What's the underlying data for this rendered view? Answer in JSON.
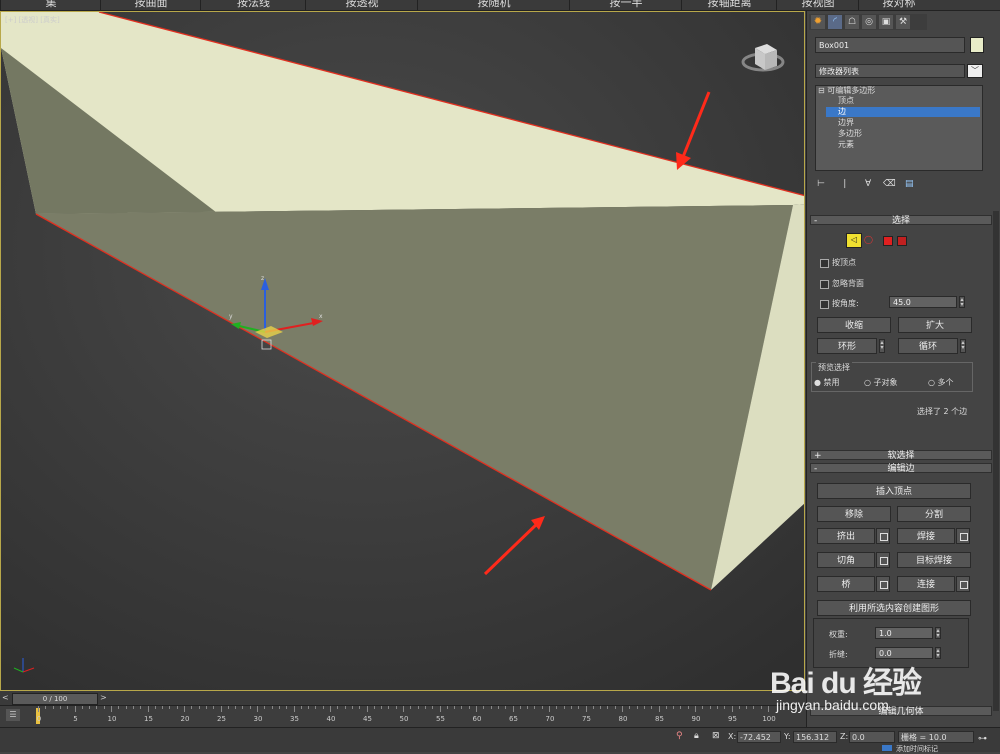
{
  "menu": {
    "items": [
      "集",
      "按曲面",
      "按法线",
      "按透视",
      "按随机",
      "按一半",
      "按轴距离",
      "按视图",
      "按对称"
    ]
  },
  "viewport": {
    "label": "[+] [透视] [真实]"
  },
  "panel": {
    "object_name": "Box001",
    "modifier_list": "修改器列表",
    "stack": {
      "root": "可编辑多边形",
      "items": [
        "顶点",
        "边",
        "边界",
        "多边形",
        "元素"
      ],
      "selected_index": 1
    },
    "selection": {
      "title": "选择",
      "by_vertex": "按顶点",
      "ignore_backfacing": "忽略背面",
      "by_angle": "按角度:",
      "angle_value": "45.0",
      "shrink": "收缩",
      "grow": "扩大",
      "ring": "环形",
      "loop": "循环",
      "preview_title": "预览选择",
      "preview_off": "禁用",
      "preview_subobj": "子对象",
      "preview_multi": "多个",
      "status": "选择了 2 个边"
    },
    "soft_selection": {
      "title": "软选择"
    },
    "edit_edges": {
      "title": "编辑边",
      "insert_vertex": "插入顶点",
      "remove": "移除",
      "split": "分割",
      "extrude": "挤出",
      "weld": "焊接",
      "chamfer": "切角",
      "target_weld": "目标焊接",
      "bridge": "桥",
      "connect": "连接",
      "create_shape": "利用所选内容创建图形",
      "weight_label": "权重:",
      "weight_value": "1.0",
      "crease_label": "折缝:",
      "crease_value": "0.0"
    },
    "edit_geometry": {
      "title": "编辑几何体"
    }
  },
  "timeline": {
    "frame": "0 / 100",
    "ticks": [
      "0",
      "5",
      "10",
      "15",
      "20",
      "25",
      "30",
      "35",
      "40",
      "45",
      "50",
      "55",
      "60",
      "65",
      "70",
      "75",
      "80",
      "85",
      "90",
      "95",
      "100"
    ]
  },
  "status": {
    "x_label": "X:",
    "x_value": "-72.452",
    "y_label": "Y:",
    "y_value": "156.312",
    "z_label": "Z:",
    "z_value": "0.0",
    "grid": "栅格 = 10.0",
    "add_tag": "添加时间标记"
  },
  "watermark": {
    "brand": "Bai du 经验",
    "url": "jingyan.baidu.com"
  },
  "colors": {
    "viewport_border": "#b8a84a",
    "selection_red": "#e03020",
    "box_top": "#e4e6c7",
    "box_front": "#777a65",
    "box_side": "#dcdec0",
    "highlight_blue": "#3a78c8"
  }
}
